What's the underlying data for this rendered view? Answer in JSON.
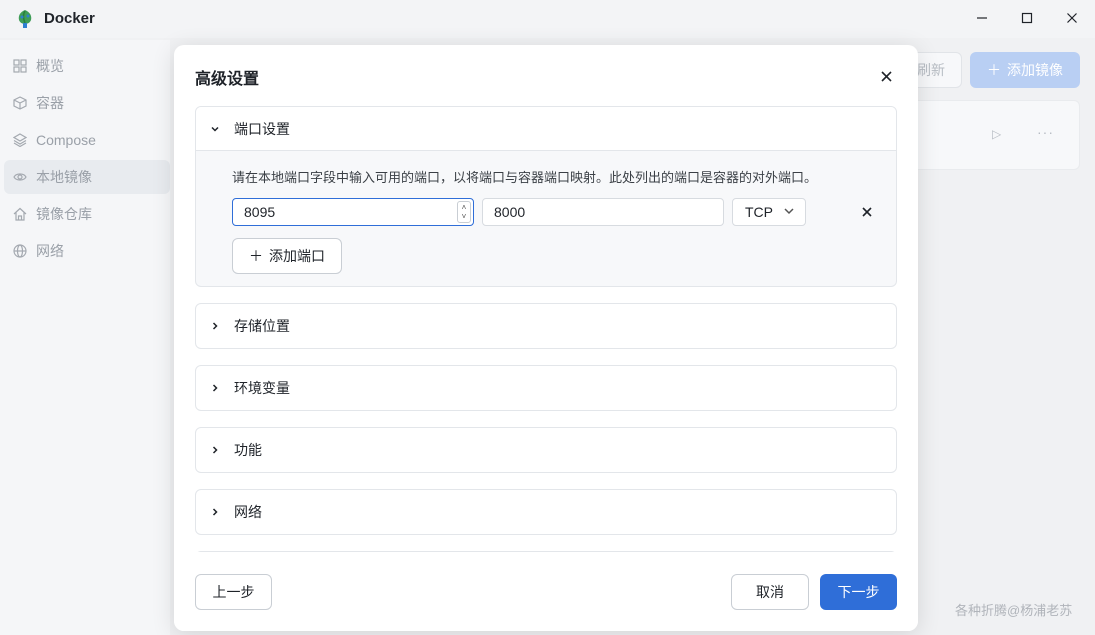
{
  "window": {
    "title": "Docker",
    "minimize_icon": "minimize-icon",
    "maximize_icon": "maximize-icon",
    "close_icon": "close-icon"
  },
  "sidebar": {
    "items": [
      {
        "label": "概览",
        "icon": "grid-icon"
      },
      {
        "label": "容器",
        "icon": "cube-icon"
      },
      {
        "label": "Compose",
        "icon": "layers-icon"
      },
      {
        "label": "本地镜像",
        "icon": "eye-icon",
        "active": true
      },
      {
        "label": "镜像仓库",
        "icon": "home-icon"
      },
      {
        "label": "网络",
        "icon": "globe-icon"
      }
    ]
  },
  "toolbar": {
    "refresh_label": "刷新",
    "add_image_label": "添加镜像"
  },
  "watermark": "各种折腾@杨浦老苏",
  "modal": {
    "title": "高级设置",
    "sections": {
      "ports": {
        "title": "端口设置",
        "description": "请在本地端口字段中输入可用的端口，以将端口与容器端口映射。此处列出的端口是容器的对外端口。",
        "rows": [
          {
            "local_port": "8095",
            "container_port": "8000",
            "protocol": "TCP"
          }
        ],
        "add_port_label": "添加端口"
      },
      "storage": {
        "title": "存储位置"
      },
      "env": {
        "title": "环境变量"
      },
      "features": {
        "title": "功能"
      },
      "network": {
        "title": "网络"
      }
    },
    "footer": {
      "prev_label": "上一步",
      "cancel_label": "取消",
      "next_label": "下一步"
    }
  },
  "colors": {
    "accent": "#2f6ed8",
    "accent_disabled": "#b9cff3"
  }
}
